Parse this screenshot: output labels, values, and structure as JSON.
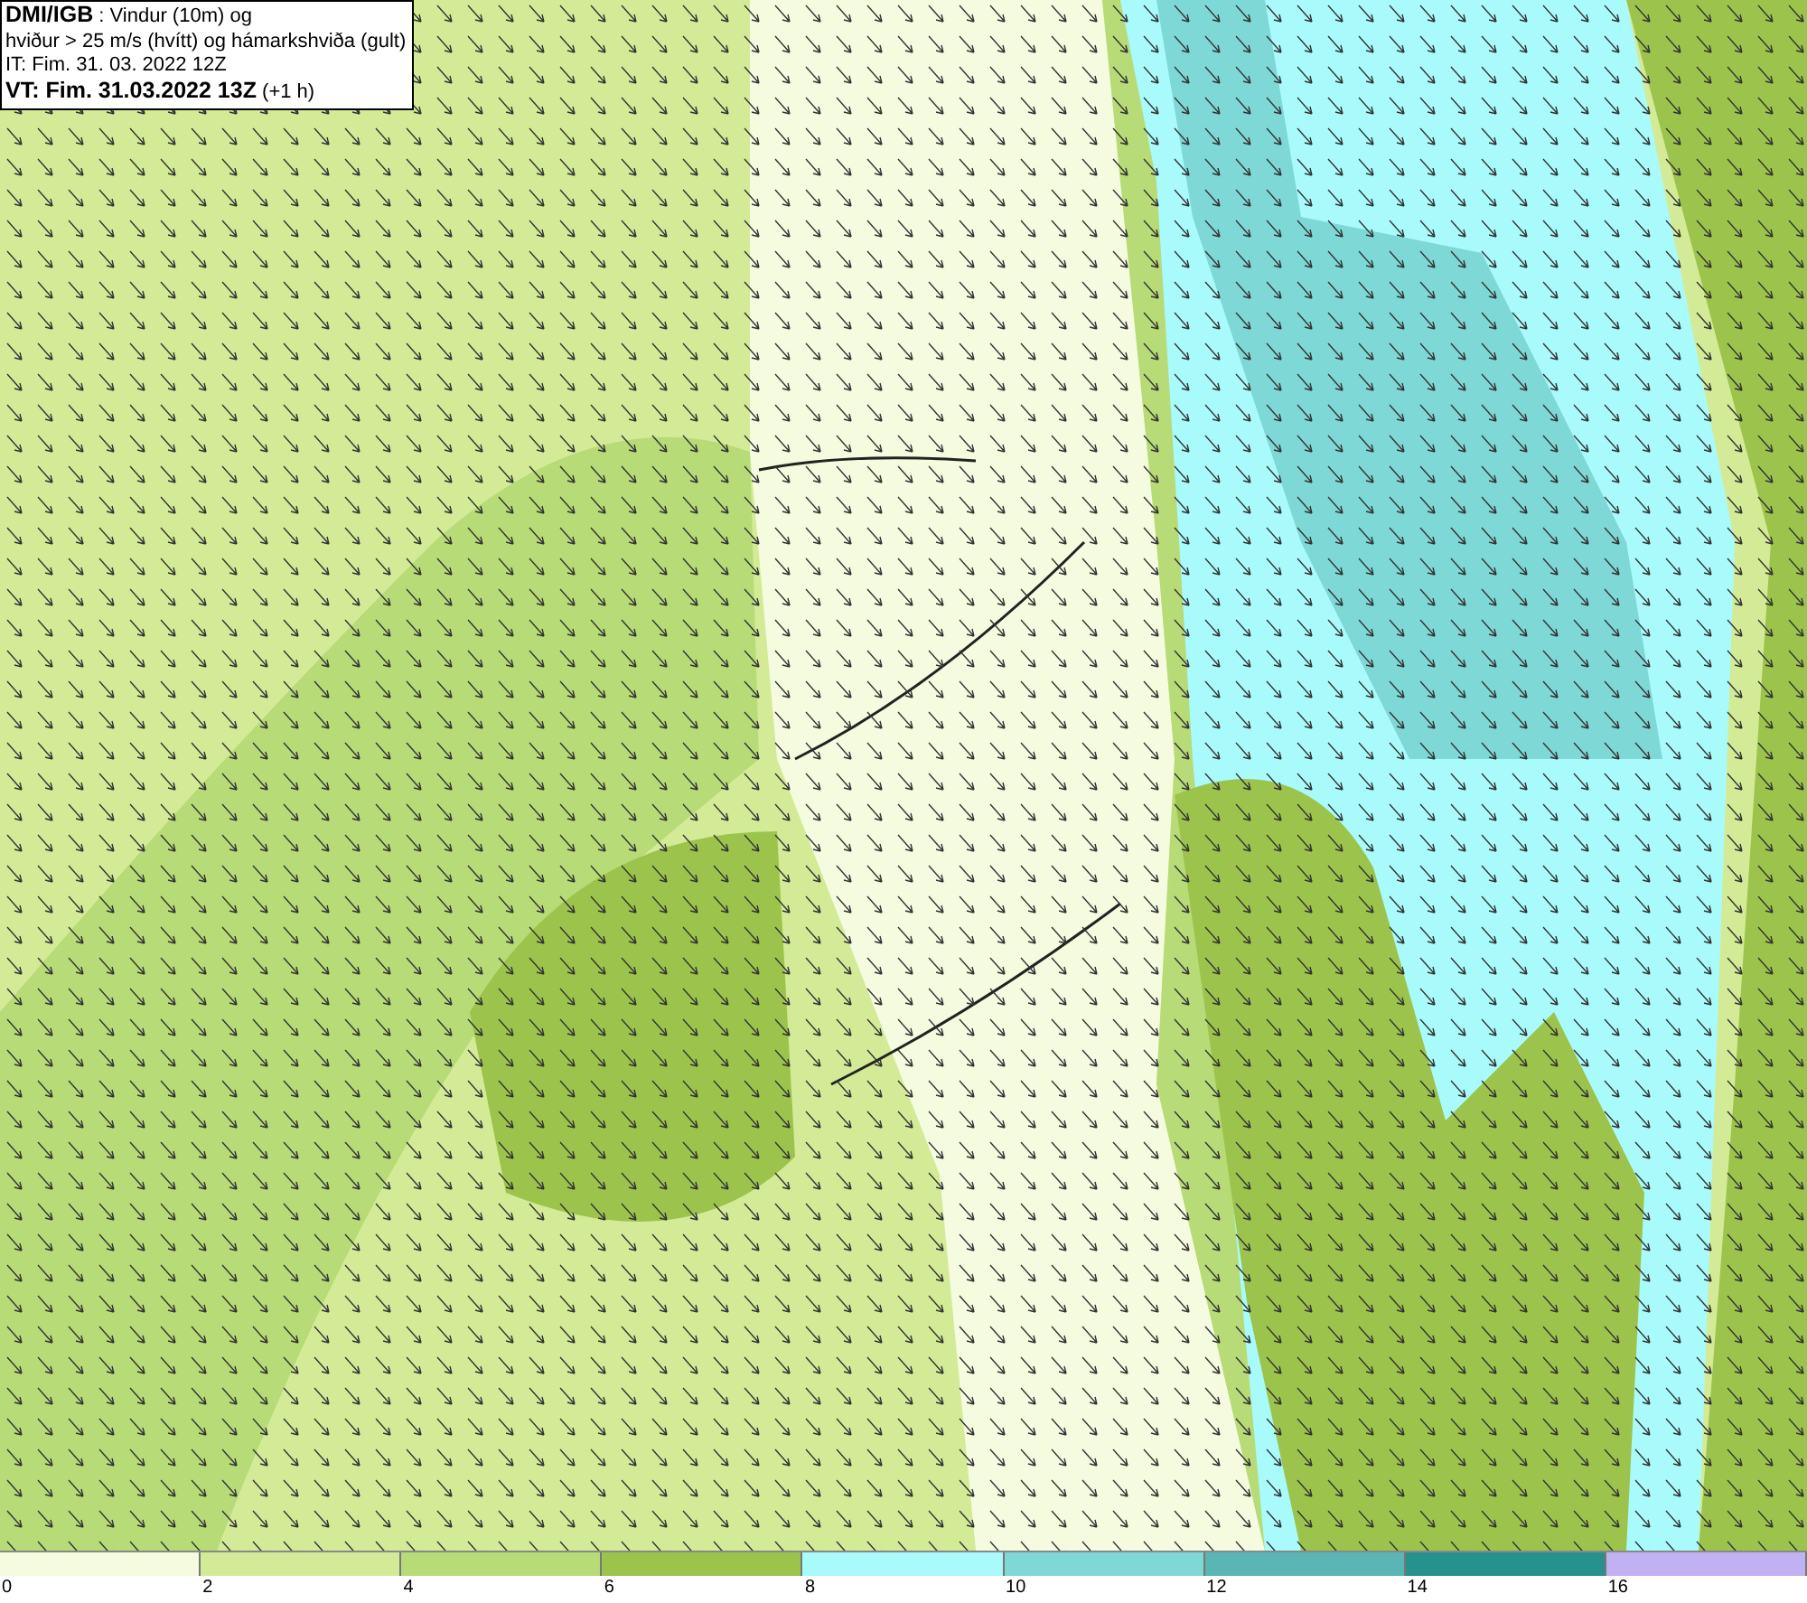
{
  "header": {
    "lines": [
      "**DMI/IGB** : Vindur (10m) og",
      "hviður > 25 m/s (hvítt) og hámarkshviða (gult)",
      "IT: Fim. 31. 03. 2022 12Z",
      "**VT: Fim. 31.03.2022 13Z** (+1 h)"
    ]
  },
  "colorbar": {
    "bins": [
      {
        "color": "#f4fbdf",
        "tick": "0"
      },
      {
        "color": "#d3eb97",
        "tick": "2"
      },
      {
        "color": "#b7db77",
        "tick": "4"
      },
      {
        "color": "#9cc44c",
        "tick": "6"
      },
      {
        "color": "#a9fbfb",
        "tick": "8"
      },
      {
        "color": "#7ed8d5",
        "tick": "10"
      },
      {
        "color": "#59b6b4",
        "tick": "12"
      },
      {
        "color": "#27918e",
        "tick": "14"
      },
      {
        "color": "#c1b1f2",
        "tick": "16"
      }
    ]
  }
}
